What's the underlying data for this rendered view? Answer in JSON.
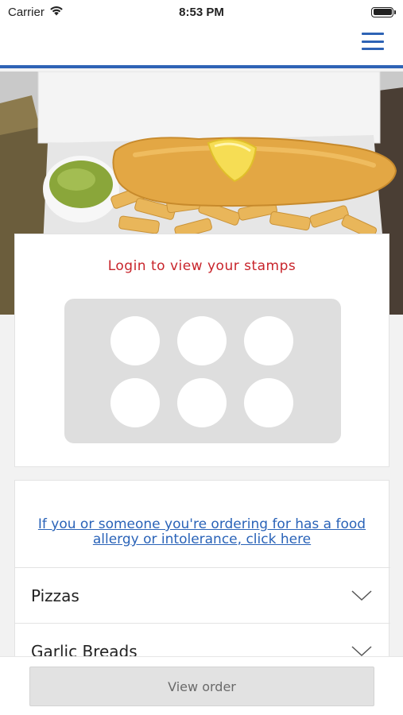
{
  "status_bar": {
    "carrier": "Carrier",
    "time": "8:53 PM",
    "icons": [
      "wifi-icon",
      "battery-icon"
    ]
  },
  "header": {
    "menu_icon": "hamburger-menu-icon",
    "accent_color": "#2e63b5"
  },
  "hero": {
    "image_subject": "fish-and-chips-photo"
  },
  "stamps": {
    "title": "Login to view your stamps",
    "title_color": "#c8242b",
    "stamp_count": 6
  },
  "menu": {
    "allergy_link": "If you or someone you're ordering for has a food allergy or intolerance, click here",
    "link_color": "#2a63b8",
    "categories": [
      {
        "label": "Pizzas",
        "icon": "chevron-down-icon"
      },
      {
        "label": "Garlic Breads",
        "icon": "chevron-down-icon"
      }
    ]
  },
  "bottom": {
    "view_order_label": "View order"
  }
}
